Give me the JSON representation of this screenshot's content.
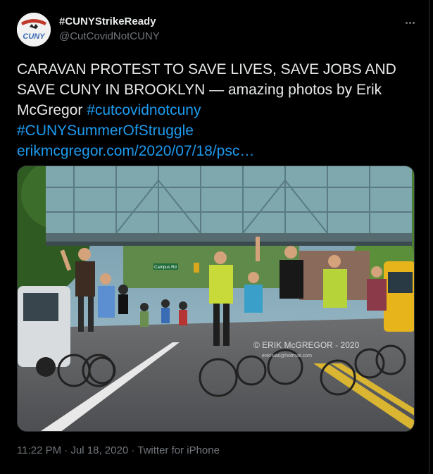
{
  "author": {
    "display_name": "#CUNYStrikeReady",
    "handle": "@CutCovidNotCUNY",
    "avatar_text": "CUNY"
  },
  "tweet": {
    "text_main": "CARAVAN PROTEST TO SAVE LIVES, SAVE JOBS AND SAVE CUNY IN BROOKLYN — amazing photos by Erik McGregor ",
    "hashtag1": "#cutcovidnotcuny",
    "hashtag2": "#CUNYSummerOfStruggle",
    "link": "erikmcgregor.com/2020/07/18/psc…"
  },
  "photo": {
    "watermark": "© ERIK McGREGOR - 2020",
    "watermark_email": "erikrivas@hotmail.com",
    "street_sign": "Campus Rd"
  },
  "meta": {
    "time": "11:22 PM",
    "date": "Jul 18, 2020",
    "source": "Twitter for iPhone",
    "separator": " · "
  },
  "icons": {
    "more": "more-horizontal-icon"
  }
}
